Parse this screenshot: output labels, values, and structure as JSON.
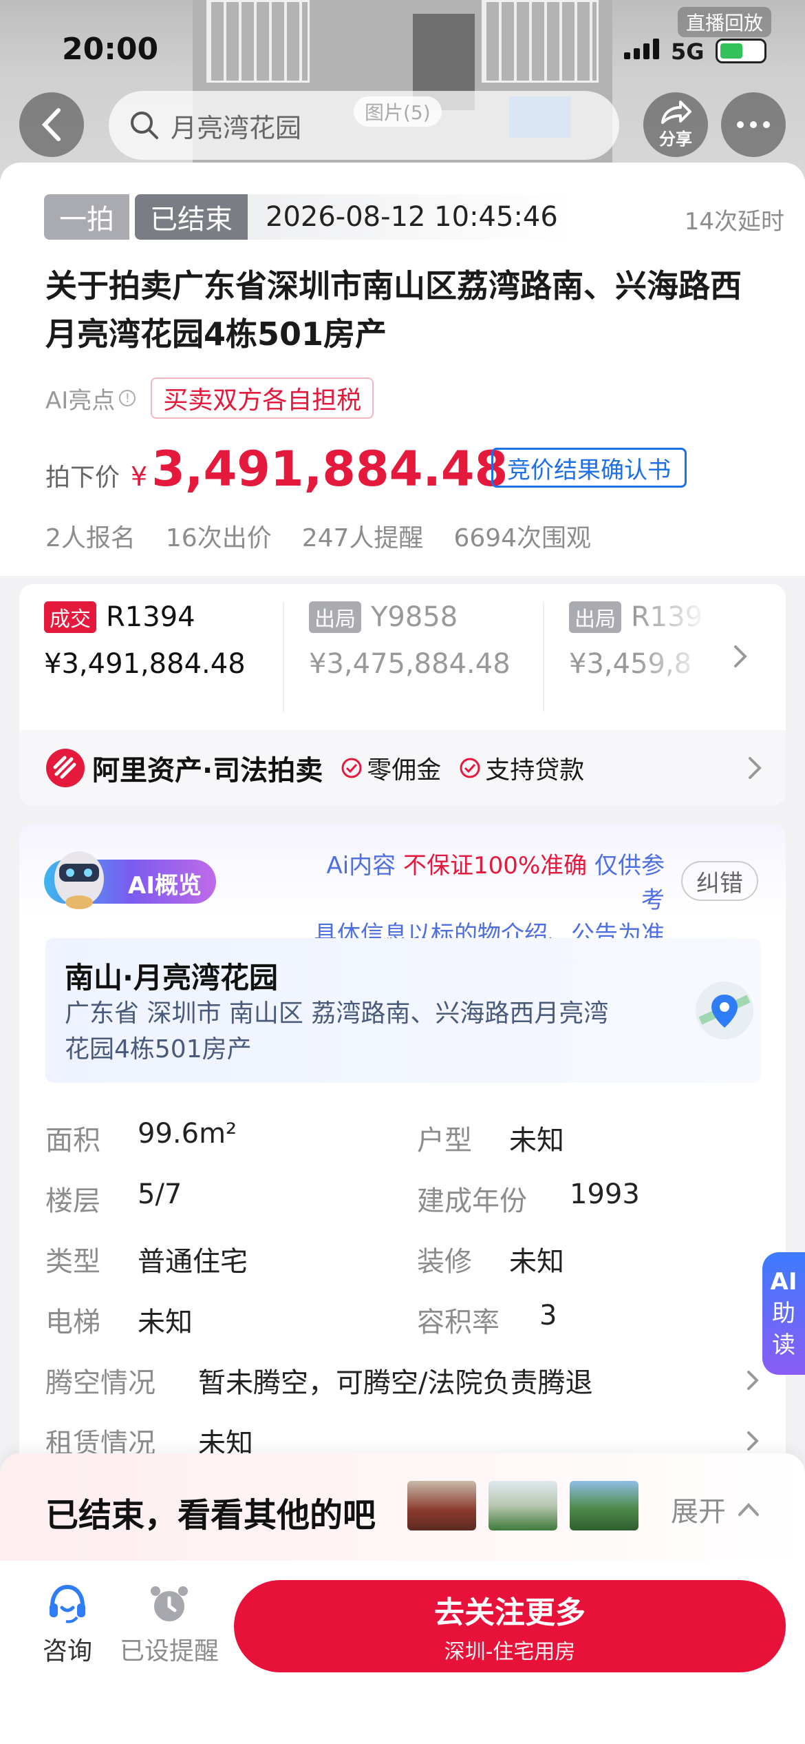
{
  "status_bar": {
    "time": "20:00",
    "network": "5G",
    "live_replay": "直播回放"
  },
  "nav": {
    "search_text": "月亮湾花园",
    "pictures_pill": "图片(5)",
    "share_label": "分享"
  },
  "auction": {
    "round_tag": "一拍",
    "status_tag": "已结束",
    "datetime": "2026-08-12 10:45:46",
    "delays": "14次延时",
    "title": "关于拍卖广东省深圳市南山区荔湾路南、兴海路西月亮湾花园4栋501房产",
    "ai_highlight_label": "AI亮点",
    "tax_tag": "买卖双方各自担税",
    "price_label": "拍下价",
    "currency": "¥",
    "price": "3,491,884.48",
    "confirm_button": "竞价结果确认书",
    "stats": [
      "2人报名",
      "16次出价",
      "247人提醒",
      "6694次围观"
    ]
  },
  "bids": [
    {
      "status": "成交",
      "code": "R1394",
      "price": "¥3,491,884.48"
    },
    {
      "status": "出局",
      "code": "Y9858",
      "price": "¥3,475,884.48"
    },
    {
      "status": "出局",
      "code": "R139",
      "price": "¥3,459,8"
    }
  ],
  "platform": {
    "name": "阿里资产·司法拍卖",
    "feature1": "零佣金",
    "feature2": "支持贷款"
  },
  "ai_overview": {
    "badge": "AI概览",
    "notice_prefix": "Ai内容",
    "notice_strong": "不保证100%准确",
    "notice_suffix": "仅供参考",
    "notice_line2": "具体信息以标的物介绍、公告为准",
    "correct_button": "纠错"
  },
  "location": {
    "name": "南山·月亮湾花园",
    "address": "广东省 深圳市 南山区 荔湾路南、兴海路西月亮湾花园4栋501房产"
  },
  "details": [
    {
      "label": "面积",
      "value": "99.6m²"
    },
    {
      "label": "户型",
      "value": "未知"
    },
    {
      "label": "楼层",
      "value": "5/7"
    },
    {
      "label": "建成年份",
      "value": "1993"
    },
    {
      "label": "类型",
      "value": "普通住宅"
    },
    {
      "label": "装修",
      "value": "未知"
    },
    {
      "label": "电梯",
      "value": "未知"
    },
    {
      "label": "容积率",
      "value": "3"
    }
  ],
  "vacancy": {
    "label": "腾空情况",
    "value": "暂未腾空，可腾空/法院负责腾退"
  },
  "lease": {
    "label": "租赁情况",
    "value": "未知"
  },
  "ai_reader": {
    "line1": "AI",
    "line2": "助",
    "line3": "读"
  },
  "ended_banner": {
    "text": "已结束，看看其他的吧",
    "expand": "展开"
  },
  "bottom_bar": {
    "consult": "咨询",
    "reminder": "已设提醒",
    "cta_main": "去关注更多",
    "cta_sub": "深圳-住宅用房"
  },
  "colors": {
    "accent_red": "#e5193c",
    "ai_blue": "#4e6fe0",
    "link_blue": "#1f6fe5"
  }
}
